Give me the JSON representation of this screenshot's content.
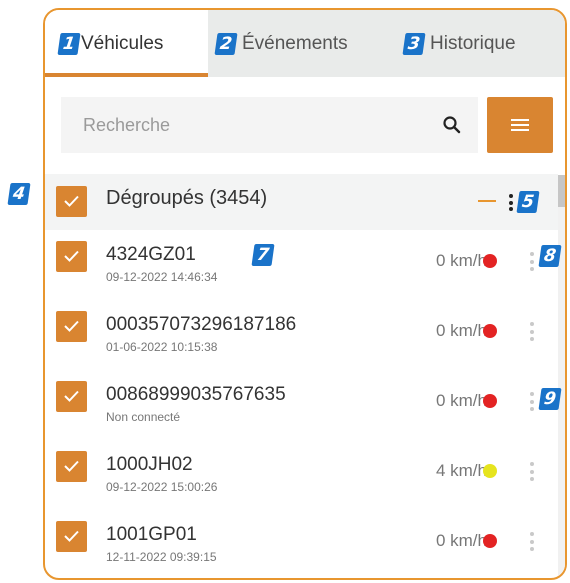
{
  "tabs": [
    {
      "badge": "1",
      "label": "Véhicules",
      "active": true
    },
    {
      "badge": "2",
      "label": "Événements",
      "active": false
    },
    {
      "badge": "3",
      "label": "Historique",
      "active": false
    }
  ],
  "search": {
    "placeholder": "Recherche"
  },
  "group": {
    "label": "Dégroupés (3454)",
    "checked": true
  },
  "callouts": {
    "group_checkbox": "4",
    "group_menu": "5",
    "vehicle_name": "7",
    "vehicle_menu": "8",
    "vehicle_menu_alt": "9"
  },
  "vehicles": [
    {
      "name": "4324GZ01",
      "date": "09-12-2022 14:46:34",
      "speed": "0 km/h",
      "status_color": "#e32323",
      "checked": true
    },
    {
      "name": "000357073296187186",
      "date": "01-06-2022 10:15:38",
      "speed": "0 km/h",
      "status_color": "#e32323",
      "checked": true
    },
    {
      "name": "00868999035767635",
      "date": "Non connecté",
      "speed": "0 km/h",
      "status_color": "#e32323",
      "checked": true
    },
    {
      "name": "1000JH02",
      "date": "09-12-2022 15:00:26",
      "speed": "4 km/h",
      "status_color": "#e6e41e",
      "checked": true
    },
    {
      "name": "1001GP01",
      "date": "12-11-2022 09:39:15",
      "speed": "0 km/h",
      "status_color": "#e32323",
      "checked": true
    }
  ],
  "colors": {
    "accent": "#d98531",
    "border": "#e8962f",
    "badge": "#1a73c9"
  }
}
